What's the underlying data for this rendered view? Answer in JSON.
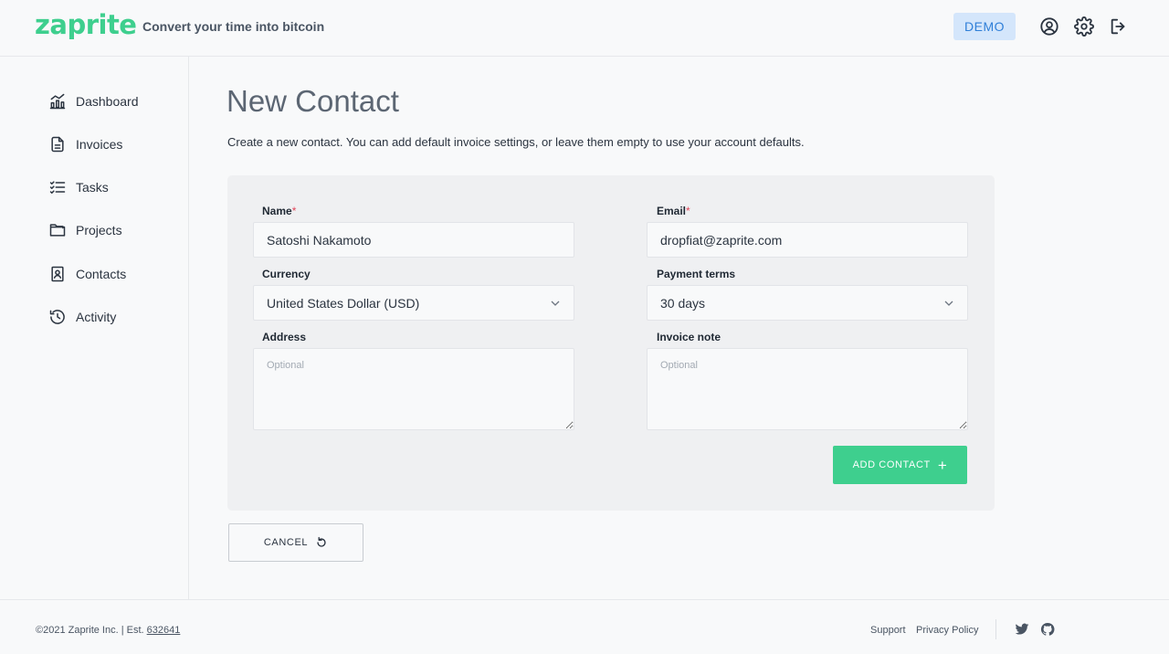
{
  "header": {
    "logo": "zaprite",
    "tagline": "Convert your time into bitcoin",
    "demo_label": "DEMO",
    "icons": [
      "user-circle-icon",
      "gear-icon",
      "logout-icon"
    ]
  },
  "sidebar": {
    "items": [
      {
        "label": "Dashboard",
        "icon": "dashboard-icon"
      },
      {
        "label": "Invoices",
        "icon": "invoice-icon"
      },
      {
        "label": "Tasks",
        "icon": "tasks-icon"
      },
      {
        "label": "Projects",
        "icon": "folder-icon"
      },
      {
        "label": "Contacts",
        "icon": "contacts-icon"
      },
      {
        "label": "Activity",
        "icon": "history-icon"
      }
    ]
  },
  "main": {
    "title": "New Contact",
    "description": "Create a new contact. You can add default invoice settings, or leave them empty to use your account defaults.",
    "form": {
      "name_label": "Name",
      "name_value": "Satoshi Nakamoto",
      "email_label": "Email",
      "email_value": "dropfiat@zaprite.com",
      "required_mark": "*",
      "currency_label": "Currency",
      "currency_value": "United States Dollar (USD)",
      "payment_terms_label": "Payment terms",
      "payment_terms_value": "30 days",
      "address_label": "Address",
      "address_placeholder": "Optional",
      "invoice_note_label": "Invoice note",
      "invoice_note_placeholder": "Optional",
      "add_button_label": "ADD CONTACT",
      "add_button_symbol": "+"
    },
    "cancel_label": "CANCEL"
  },
  "footer": {
    "copyright": "©2021 Zaprite Inc. | Est. ",
    "est_block": "632641",
    "links": [
      "Support",
      "Privacy Policy"
    ],
    "social": [
      "twitter-icon",
      "github-icon"
    ]
  },
  "colors": {
    "brand": "#3ecf8e",
    "demo_bg": "#d4e6fb",
    "demo_text": "#2f7fd8",
    "required": "#e0475b"
  }
}
